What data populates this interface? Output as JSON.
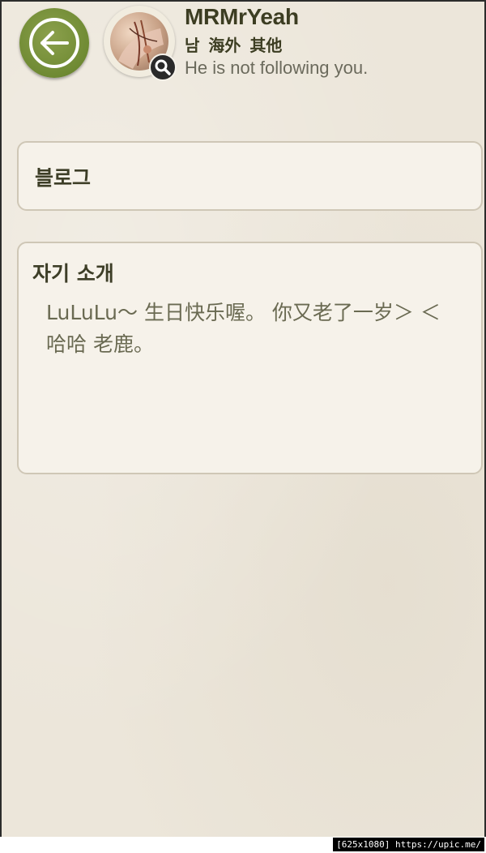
{
  "header": {
    "username": "MRMrYeah",
    "meta": "남  海外 其他",
    "follow_status": "He is not following you.",
    "back_icon": "arrow-left-icon",
    "zoom_icon": "magnifier-icon"
  },
  "blog": {
    "title": "블로그"
  },
  "intro": {
    "title": "자기 소개",
    "text": "LuLuLu〜 生日快乐喔。 你又老了一岁＞ ＜ 哈哈 老鹿。"
  },
  "watermark": "[625x1080] https://upic.me/",
  "colors": {
    "background": "#ece6da",
    "accent_green": "#6f8a33",
    "card_bg": "#f6f2ea",
    "card_border": "#cfc7b6",
    "title_text": "#3c3d22",
    "body_text": "#6a6a52"
  }
}
